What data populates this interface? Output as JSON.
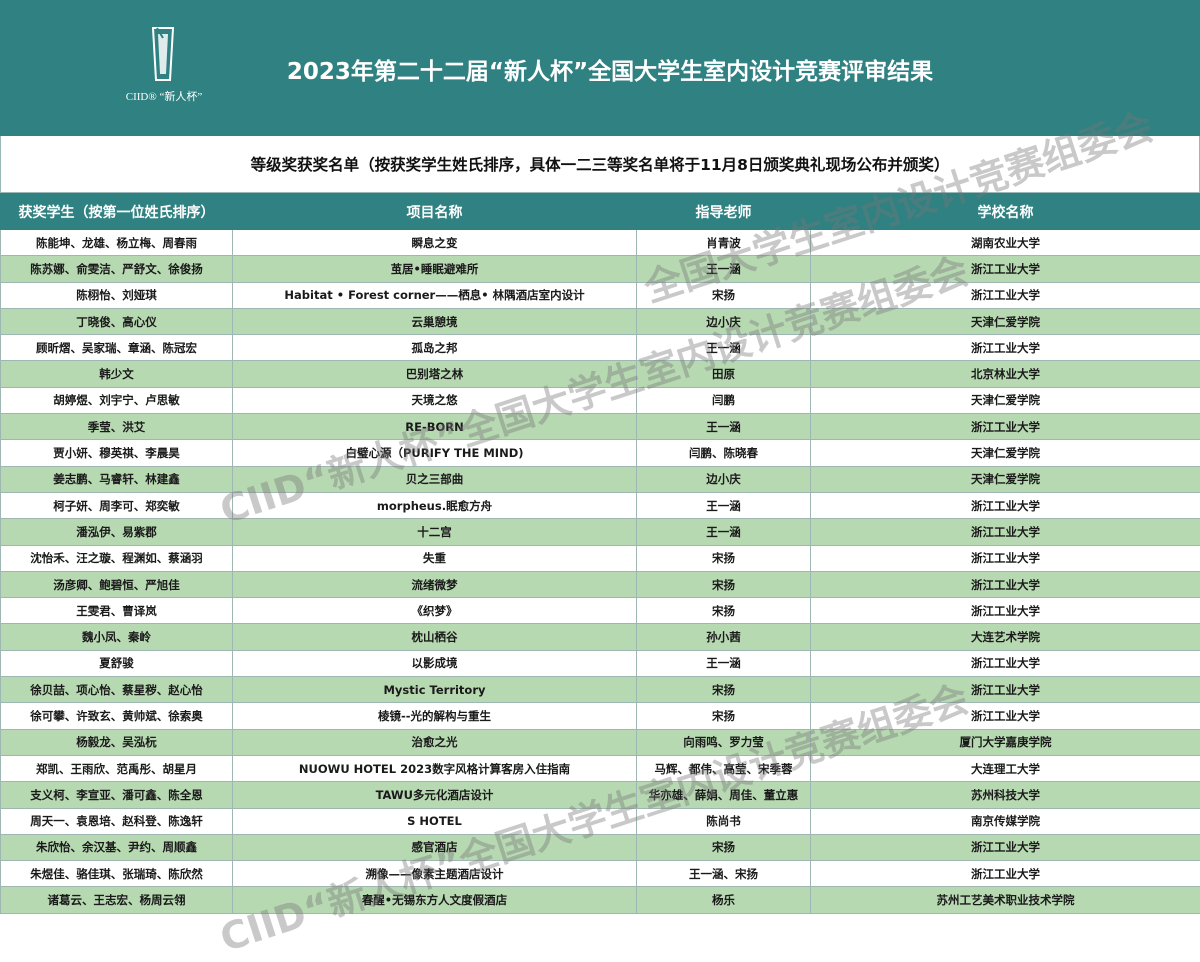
{
  "header": {
    "logo_text": "CIID® “新人杯”",
    "title": "2023年第二十二届“新人杯”全国大学生室内设计竞赛评审结果"
  },
  "subtitle": "等级奖获奖名单（按获奖学生姓氏排序，具体一二三等奖名单将于11月8日颁奖典礼现场公布并颁奖）",
  "table": {
    "headers": [
      "获奖学生（按第一位姓氏排序）",
      "项目名称",
      "指导老师",
      "学校名称"
    ],
    "rows": [
      [
        "陈能坤、龙雄、杨立梅、周春雨",
        "瞬息之变",
        "肖青波",
        "湖南农业大学"
      ],
      [
        "陈苏娜、俞雯洁、严舒文、徐俊扬",
        "茧居•睡眠避难所",
        "王一涵",
        "浙江工业大学"
      ],
      [
        "陈栩怡、刘娅琪",
        "Habitat • Forest corner——栖息• 林隅酒店室内设计",
        "宋扬",
        "浙江工业大学"
      ],
      [
        "丁晓俊、高心仪",
        "云巢憩境",
        "边小庆",
        "天津仁爱学院"
      ],
      [
        "顾昕熠、吴家瑞、章涵、陈冠宏",
        "孤岛之邦",
        "王一涵",
        "浙江工业大学"
      ],
      [
        "韩少文",
        "巴别塔之林",
        "田原",
        "北京林业大学"
      ],
      [
        "胡婷煜、刘宇宁、卢思敏",
        "天境之悠",
        "闫鹏",
        "天津仁爱学院"
      ],
      [
        "季莹、洪艾",
        "RE-BORN",
        "王一涵",
        "浙江工业大学"
      ],
      [
        "贾小妍、穆英祺、李晨昊",
        "白璧心源（PURIFY THE MIND)",
        "闫鹏、陈晓春",
        "天津仁爱学院"
      ],
      [
        "姜志鹏、马睿轩、林建鑫",
        "贝之三部曲",
        "边小庆",
        "天津仁爱学院"
      ],
      [
        "柯子妍、周李可、郑奕敏",
        "morpheus.眠愈方舟",
        "王一涵",
        "浙江工业大学"
      ],
      [
        "潘泓伊、易紫郡",
        "十二宫",
        "王一涵",
        "浙江工业大学"
      ],
      [
        "沈怡禾、汪之璇、程渊如、蔡涵羽",
        "失重",
        "宋扬",
        "浙江工业大学"
      ],
      [
        "汤彦卿、鲍碧恒、严旭佳",
        "流绪微梦",
        "宋扬",
        "浙江工业大学"
      ],
      [
        "王雯君、曹译岚",
        "《织梦》",
        "宋扬",
        "浙江工业大学"
      ],
      [
        "魏小凤、秦岭",
        "枕山栖谷",
        "孙小茜",
        "大连艺术学院"
      ],
      [
        "夏舒骏",
        "以影成境",
        "王一涵",
        "浙江工业大学"
      ],
      [
        "徐贝喆、项心怡、蔡星秽、赵心怡",
        "Mystic Territory",
        "宋扬",
        "浙江工业大学"
      ],
      [
        "徐可攀、许致玄、黄帅斌、徐索奥",
        "棱镜--光的解构与重生",
        "宋扬",
        "浙江工业大学"
      ],
      [
        "杨毅龙、吴泓杬",
        "治愈之光",
        "向雨鸣、罗力莹",
        "厦门大学嘉庚学院"
      ],
      [
        "郑凯、王雨欣、范禹彤、胡星月",
        "NUOWU HOTEL 2023数字风格计算客房入住指南",
        "马辉、都伟、高莹、宋季蓉",
        "大连理工大学"
      ],
      [
        "支义柯、李宣亚、潘可鑫、陈全恩",
        "TAWU多元化酒店设计",
        "华亦雄、薛娟、周佳、董立惠",
        "苏州科技大学"
      ],
      [
        "周天一、袁恩培、赵科登、陈逸轩",
        "S HOTEL",
        "陈尚书",
        "南京传媒学院"
      ],
      [
        "朱欣怡、余汉基、尹约、周顺鑫",
        "感官酒店",
        "宋扬",
        "浙江工业大学"
      ],
      [
        "朱煜佳、骆佳琪、张瑞琦、陈欣然",
        "溯像——像素主题酒店设计",
        "王一涵、宋扬",
        "浙江工业大学"
      ],
      [
        "诸葛云、王志宏、杨周云翎",
        "春醒•无锡东方人文度假酒店",
        "杨乐",
        "苏州工艺美术职业技术学院"
      ]
    ]
  },
  "watermark": {
    "line_1": "全国大学生室内设计竞赛组委会",
    "line_2": "CIID“新人杯”全国大学生室内设计竞赛组委会",
    "line_3": "CIID“新人杯”全国大学生室内设计竞赛组委会"
  },
  "colors": {
    "header_bg": "#2f8182",
    "row_alt": "#b7d9b2",
    "text_white": "#ffffff"
  }
}
